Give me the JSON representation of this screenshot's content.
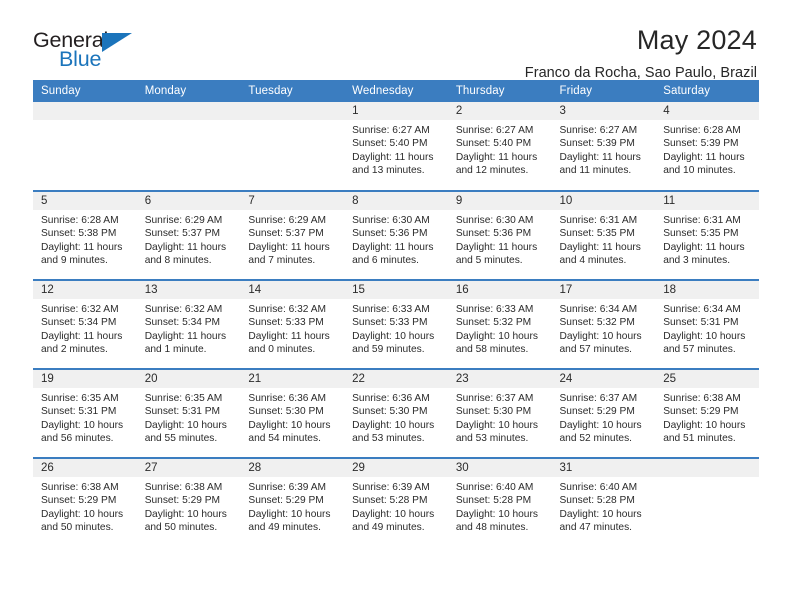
{
  "logo": {
    "word_one": "General",
    "word_two": "Blue",
    "triangle_color": "#1b74bb",
    "text_color": "#231f20"
  },
  "header": {
    "title": "May 2024",
    "location": "Franco da Rocha, Sao Paulo, Brazil"
  },
  "theme": {
    "header_blue": "#3b7dc0",
    "daynum_band": "#f0f0f0",
    "cell_background": "#ffffff",
    "text": "#2b2b2b"
  },
  "calendar": {
    "weekday_headers": [
      "Sunday",
      "Monday",
      "Tuesday",
      "Wednesday",
      "Thursday",
      "Friday",
      "Saturday"
    ],
    "weeks": [
      [
        {
          "day": "",
          "sunrise": "",
          "sunset": "",
          "daylight_line1": "",
          "daylight_line2": "",
          "empty": true
        },
        {
          "day": "",
          "sunrise": "",
          "sunset": "",
          "daylight_line1": "",
          "daylight_line2": "",
          "empty": true
        },
        {
          "day": "",
          "sunrise": "",
          "sunset": "",
          "daylight_line1": "",
          "daylight_line2": "",
          "empty": true
        },
        {
          "day": "1",
          "sunrise": "Sunrise: 6:27 AM",
          "sunset": "Sunset: 5:40 PM",
          "daylight_line1": "Daylight: 11 hours",
          "daylight_line2": "and 13 minutes.",
          "empty": false
        },
        {
          "day": "2",
          "sunrise": "Sunrise: 6:27 AM",
          "sunset": "Sunset: 5:40 PM",
          "daylight_line1": "Daylight: 11 hours",
          "daylight_line2": "and 12 minutes.",
          "empty": false
        },
        {
          "day": "3",
          "sunrise": "Sunrise: 6:27 AM",
          "sunset": "Sunset: 5:39 PM",
          "daylight_line1": "Daylight: 11 hours",
          "daylight_line2": "and 11 minutes.",
          "empty": false
        },
        {
          "day": "4",
          "sunrise": "Sunrise: 6:28 AM",
          "sunset": "Sunset: 5:39 PM",
          "daylight_line1": "Daylight: 11 hours",
          "daylight_line2": "and 10 minutes.",
          "empty": false
        }
      ],
      [
        {
          "day": "5",
          "sunrise": "Sunrise: 6:28 AM",
          "sunset": "Sunset: 5:38 PM",
          "daylight_line1": "Daylight: 11 hours",
          "daylight_line2": "and 9 minutes.",
          "empty": false
        },
        {
          "day": "6",
          "sunrise": "Sunrise: 6:29 AM",
          "sunset": "Sunset: 5:37 PM",
          "daylight_line1": "Daylight: 11 hours",
          "daylight_line2": "and 8 minutes.",
          "empty": false
        },
        {
          "day": "7",
          "sunrise": "Sunrise: 6:29 AM",
          "sunset": "Sunset: 5:37 PM",
          "daylight_line1": "Daylight: 11 hours",
          "daylight_line2": "and 7 minutes.",
          "empty": false
        },
        {
          "day": "8",
          "sunrise": "Sunrise: 6:30 AM",
          "sunset": "Sunset: 5:36 PM",
          "daylight_line1": "Daylight: 11 hours",
          "daylight_line2": "and 6 minutes.",
          "empty": false
        },
        {
          "day": "9",
          "sunrise": "Sunrise: 6:30 AM",
          "sunset": "Sunset: 5:36 PM",
          "daylight_line1": "Daylight: 11 hours",
          "daylight_line2": "and 5 minutes.",
          "empty": false
        },
        {
          "day": "10",
          "sunrise": "Sunrise: 6:31 AM",
          "sunset": "Sunset: 5:35 PM",
          "daylight_line1": "Daylight: 11 hours",
          "daylight_line2": "and 4 minutes.",
          "empty": false
        },
        {
          "day": "11",
          "sunrise": "Sunrise: 6:31 AM",
          "sunset": "Sunset: 5:35 PM",
          "daylight_line1": "Daylight: 11 hours",
          "daylight_line2": "and 3 minutes.",
          "empty": false
        }
      ],
      [
        {
          "day": "12",
          "sunrise": "Sunrise: 6:32 AM",
          "sunset": "Sunset: 5:34 PM",
          "daylight_line1": "Daylight: 11 hours",
          "daylight_line2": "and 2 minutes.",
          "empty": false
        },
        {
          "day": "13",
          "sunrise": "Sunrise: 6:32 AM",
          "sunset": "Sunset: 5:34 PM",
          "daylight_line1": "Daylight: 11 hours",
          "daylight_line2": "and 1 minute.",
          "empty": false
        },
        {
          "day": "14",
          "sunrise": "Sunrise: 6:32 AM",
          "sunset": "Sunset: 5:33 PM",
          "daylight_line1": "Daylight: 11 hours",
          "daylight_line2": "and 0 minutes.",
          "empty": false
        },
        {
          "day": "15",
          "sunrise": "Sunrise: 6:33 AM",
          "sunset": "Sunset: 5:33 PM",
          "daylight_line1": "Daylight: 10 hours",
          "daylight_line2": "and 59 minutes.",
          "empty": false
        },
        {
          "day": "16",
          "sunrise": "Sunrise: 6:33 AM",
          "sunset": "Sunset: 5:32 PM",
          "daylight_line1": "Daylight: 10 hours",
          "daylight_line2": "and 58 minutes.",
          "empty": false
        },
        {
          "day": "17",
          "sunrise": "Sunrise: 6:34 AM",
          "sunset": "Sunset: 5:32 PM",
          "daylight_line1": "Daylight: 10 hours",
          "daylight_line2": "and 57 minutes.",
          "empty": false
        },
        {
          "day": "18",
          "sunrise": "Sunrise: 6:34 AM",
          "sunset": "Sunset: 5:31 PM",
          "daylight_line1": "Daylight: 10 hours",
          "daylight_line2": "and 57 minutes.",
          "empty": false
        }
      ],
      [
        {
          "day": "19",
          "sunrise": "Sunrise: 6:35 AM",
          "sunset": "Sunset: 5:31 PM",
          "daylight_line1": "Daylight: 10 hours",
          "daylight_line2": "and 56 minutes.",
          "empty": false
        },
        {
          "day": "20",
          "sunrise": "Sunrise: 6:35 AM",
          "sunset": "Sunset: 5:31 PM",
          "daylight_line1": "Daylight: 10 hours",
          "daylight_line2": "and 55 minutes.",
          "empty": false
        },
        {
          "day": "21",
          "sunrise": "Sunrise: 6:36 AM",
          "sunset": "Sunset: 5:30 PM",
          "daylight_line1": "Daylight: 10 hours",
          "daylight_line2": "and 54 minutes.",
          "empty": false
        },
        {
          "day": "22",
          "sunrise": "Sunrise: 6:36 AM",
          "sunset": "Sunset: 5:30 PM",
          "daylight_line1": "Daylight: 10 hours",
          "daylight_line2": "and 53 minutes.",
          "empty": false
        },
        {
          "day": "23",
          "sunrise": "Sunrise: 6:37 AM",
          "sunset": "Sunset: 5:30 PM",
          "daylight_line1": "Daylight: 10 hours",
          "daylight_line2": "and 53 minutes.",
          "empty": false
        },
        {
          "day": "24",
          "sunrise": "Sunrise: 6:37 AM",
          "sunset": "Sunset: 5:29 PM",
          "daylight_line1": "Daylight: 10 hours",
          "daylight_line2": "and 52 minutes.",
          "empty": false
        },
        {
          "day": "25",
          "sunrise": "Sunrise: 6:38 AM",
          "sunset": "Sunset: 5:29 PM",
          "daylight_line1": "Daylight: 10 hours",
          "daylight_line2": "and 51 minutes.",
          "empty": false
        }
      ],
      [
        {
          "day": "26",
          "sunrise": "Sunrise: 6:38 AM",
          "sunset": "Sunset: 5:29 PM",
          "daylight_line1": "Daylight: 10 hours",
          "daylight_line2": "and 50 minutes.",
          "empty": false
        },
        {
          "day": "27",
          "sunrise": "Sunrise: 6:38 AM",
          "sunset": "Sunset: 5:29 PM",
          "daylight_line1": "Daylight: 10 hours",
          "daylight_line2": "and 50 minutes.",
          "empty": false
        },
        {
          "day": "28",
          "sunrise": "Sunrise: 6:39 AM",
          "sunset": "Sunset: 5:29 PM",
          "daylight_line1": "Daylight: 10 hours",
          "daylight_line2": "and 49 minutes.",
          "empty": false
        },
        {
          "day": "29",
          "sunrise": "Sunrise: 6:39 AM",
          "sunset": "Sunset: 5:28 PM",
          "daylight_line1": "Daylight: 10 hours",
          "daylight_line2": "and 49 minutes.",
          "empty": false
        },
        {
          "day": "30",
          "sunrise": "Sunrise: 6:40 AM",
          "sunset": "Sunset: 5:28 PM",
          "daylight_line1": "Daylight: 10 hours",
          "daylight_line2": "and 48 minutes.",
          "empty": false
        },
        {
          "day": "31",
          "sunrise": "Sunrise: 6:40 AM",
          "sunset": "Sunset: 5:28 PM",
          "daylight_line1": "Daylight: 10 hours",
          "daylight_line2": "and 47 minutes.",
          "empty": false
        },
        {
          "day": "",
          "sunrise": "",
          "sunset": "",
          "daylight_line1": "",
          "daylight_line2": "",
          "empty": true
        }
      ]
    ]
  }
}
